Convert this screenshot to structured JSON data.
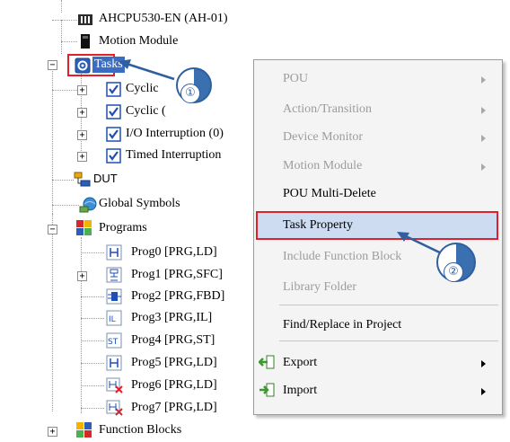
{
  "tree": {
    "cpu": "AHCPU530-EN  (AH-01)",
    "motion_module": "Motion Module",
    "tasks": "Tasks",
    "task_children": [
      "Cyclic",
      "Cyclic (",
      "I/O Interruption (0)",
      "Timed Interruption"
    ],
    "dut": "DUT",
    "global_symbols": "Global Symbols",
    "programs": "Programs",
    "program_items": [
      "Prog0 [PRG,LD]",
      "Prog1 [PRG,SFC]",
      "Prog2 [PRG,FBD]",
      "Prog3 [PRG,IL]",
      "Prog4 [PRG,ST]",
      "Prog5 [PRG,LD]",
      "Prog6 [PRG,LD]",
      "Prog7 [PRG,LD]"
    ],
    "function_blocks": "Function Blocks",
    "expander_plus": "+",
    "expander_minus": "−"
  },
  "context_menu": {
    "items": [
      {
        "label": "POU",
        "enabled": false,
        "submenu": true
      },
      {
        "label": "Action/Transition",
        "enabled": false,
        "submenu": true
      },
      {
        "label": "Device Monitor",
        "enabled": false,
        "submenu": true
      },
      {
        "label": "Motion Module",
        "enabled": false,
        "submenu": true
      },
      {
        "label": "POU Multi-Delete",
        "enabled": true,
        "submenu": false
      },
      {
        "label": "Task Property",
        "enabled": true,
        "submenu": false,
        "highlighted": true
      },
      {
        "label": "Include Function Block",
        "enabled": false,
        "submenu": false
      },
      {
        "label": "Library Folder",
        "enabled": false,
        "submenu": false
      },
      {
        "label": "Find/Replace in Project",
        "enabled": true,
        "submenu": false
      },
      {
        "label": "Export",
        "enabled": true,
        "submenu": true
      },
      {
        "label": "Import",
        "enabled": true,
        "submenu": true
      }
    ]
  },
  "callouts": {
    "step1": "①",
    "step2": "②"
  },
  "colors": {
    "highlight_border": "#e0202c",
    "menu_highlight": "#cddcf0",
    "callout_blue": "#3a6fb0",
    "check_blue": "#1f4fb4"
  }
}
